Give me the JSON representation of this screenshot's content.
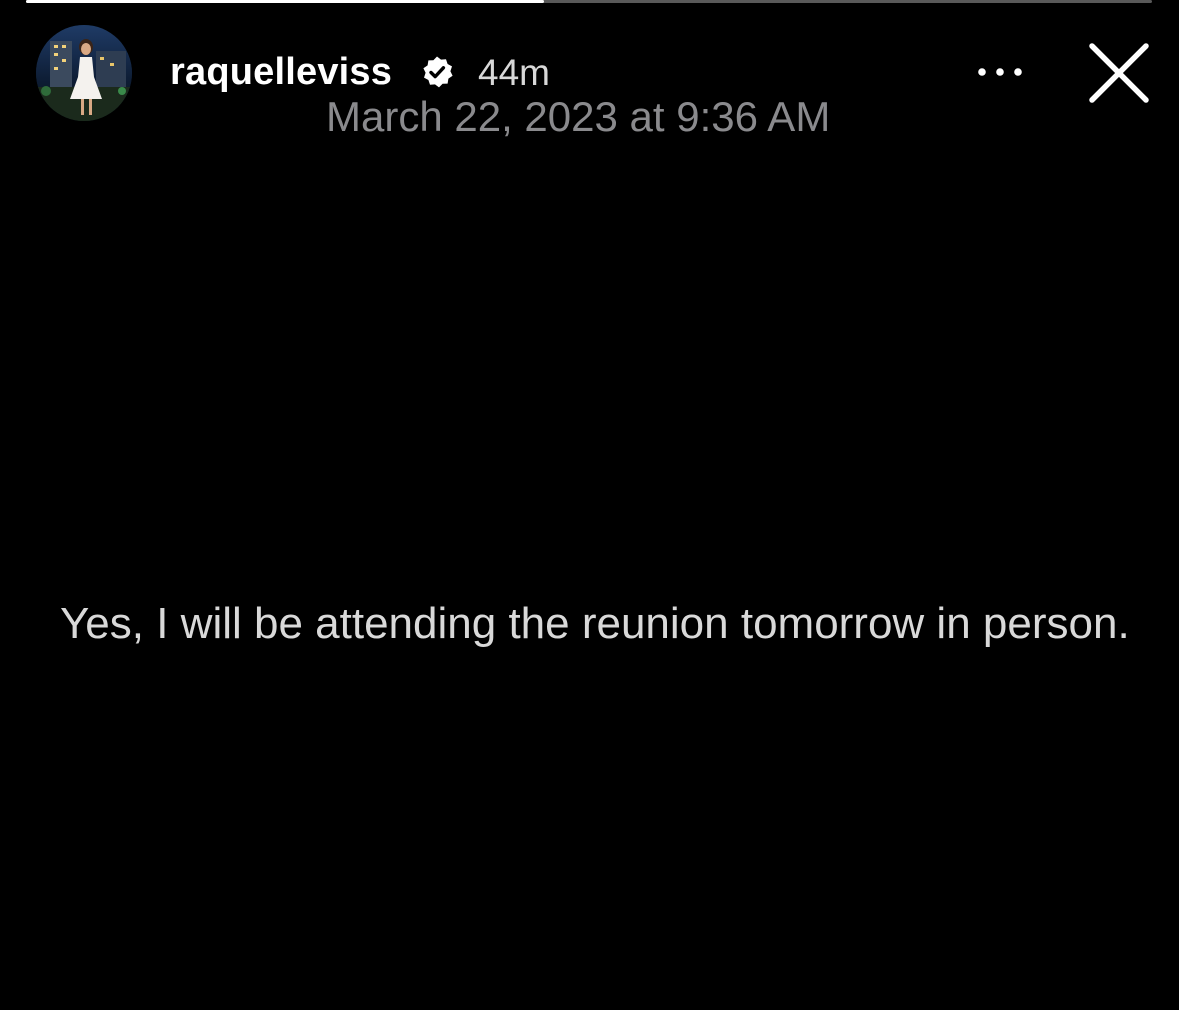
{
  "story": {
    "progress": 0.46,
    "username": "raquelleviss",
    "verified": true,
    "time_ago": "44m",
    "more_icon": "more-horizontal-icon",
    "close_icon": "close-icon"
  },
  "post": {
    "date": "March 22, 2023 at 9:36 AM",
    "text": "Yes, I will be attending the reunion tomorrow in person."
  },
  "colors": {
    "background": "#000000",
    "username": "#ffffff",
    "date": "#8a8a8d",
    "body_text": "#d9d9d9"
  }
}
